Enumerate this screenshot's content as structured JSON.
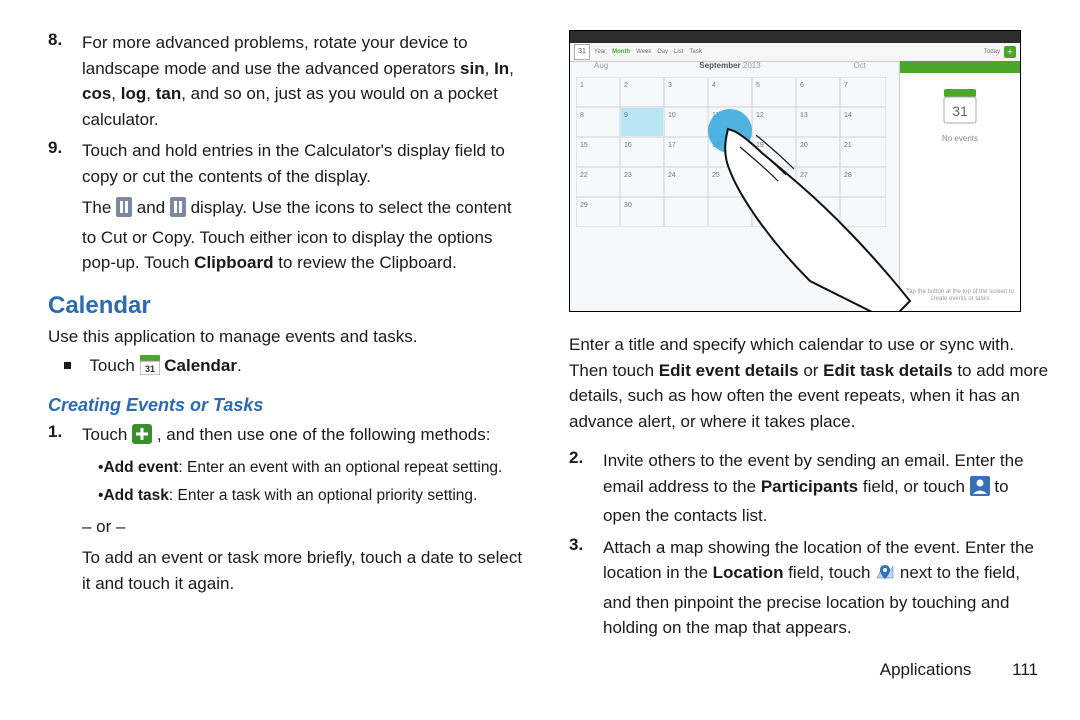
{
  "left": {
    "step8": {
      "num": "8.",
      "p1_a": "For more advanced problems, rotate your device to landscape mode and use the advanced operators ",
      "b1": "sin",
      "s1": ", ",
      "b2": "In",
      "s2": ", ",
      "b3": "cos",
      "s3": ", ",
      "b4": "log",
      "s4": ", ",
      "b5": "tan",
      "rest": ", and so on, just as you would on a pocket calculator."
    },
    "step9": {
      "num": "9.",
      "p1": "Touch and hold entries in the Calculator's display field to copy or cut the contents of the display.",
      "p2a": "The ",
      "p2b": " and ",
      "p2c": " display. Use the icons to select the content to Cut or Copy. Touch either icon to display the options pop-up. Touch ",
      "p2_bold": "Clipboard",
      "p2d": " to review the Clipboard."
    },
    "h2": "Calendar",
    "intro": "Use this application to manage events and tasks.",
    "touch_pre": "Touch ",
    "touch_bold": " Calendar",
    "touch_end": ".",
    "h3": "Creating Events or Tasks",
    "step1": {
      "num": "1.",
      "p1a": "Touch ",
      "p1b": " , and then use one of the following methods:",
      "b1_bold": "Add event",
      "b1_rest": ": Enter an event with an optional repeat setting.",
      "b2_bold": "Add task",
      "b2_rest": ": Enter a task with an optional priority setting.",
      "or": "– or –",
      "p2": "To add an event or task more briefly, touch a date to select it and touch it again."
    }
  },
  "right": {
    "fig": {
      "month_prev": "Aug",
      "month": "September",
      "year": " 2013",
      "month_next": "Oct",
      "day_icon": "31",
      "no_events": "No events",
      "hint": "Tap the button at the top of the screen to create events or tasks",
      "tabs": [
        "Year",
        "Month",
        "Week",
        "Day",
        "List",
        "Task"
      ],
      "today": "Today"
    },
    "p1a": "Enter a title and specify which calendar to use or sync with. Then touch ",
    "p1_b1": "Edit event details",
    "p1_mid": " or ",
    "p1_b2": "Edit task details",
    "p1b": " to add more details, such as how often the event repeats, when it has an advance alert, or where it takes place.",
    "step2": {
      "num": "2.",
      "p1a": "Invite others to the event by sending an email. Enter the email address to the ",
      "bold1": "Participants",
      "p1b": " field, or touch ",
      "p1c": " to open the contacts list."
    },
    "step3": {
      "num": "3.",
      "p1a": "Attach a map showing the location of the event. Enter the location in the ",
      "bold1": "Location",
      "p1b": " field, touch ",
      "p1c": " next to the field, and then pinpoint the precise location by touching and holding on the map that appears."
    }
  },
  "footer": {
    "section": "Applications",
    "page": "111"
  }
}
